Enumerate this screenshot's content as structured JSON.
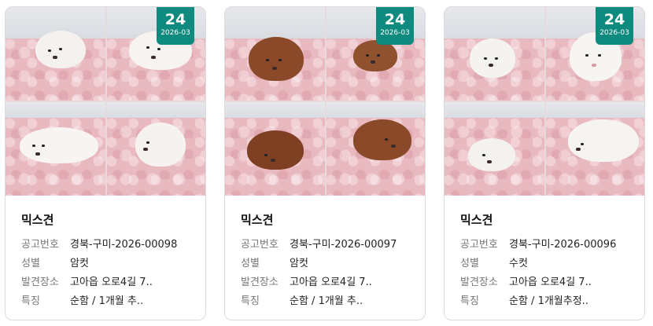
{
  "cards": [
    {
      "badge_day": "24",
      "badge_yearmonth": "2026-03",
      "breed": "믹스견",
      "labels": {
        "notice_no": "공고번호",
        "sex": "성별",
        "place": "발견장소",
        "feature": "특징"
      },
      "notice_no": "경북-구미-2026-00098",
      "sex": "암컷",
      "place": "고아읍 오로4길 7..",
      "feature": "순함 / 1개월 추..",
      "puppy_color": "#f4f1ee"
    },
    {
      "badge_day": "24",
      "badge_yearmonth": "2026-03",
      "breed": "믹스견",
      "labels": {
        "notice_no": "공고번호",
        "sex": "성별",
        "place": "발견장소",
        "feature": "특징"
      },
      "notice_no": "경북-구미-2026-00097",
      "sex": "암컷",
      "place": "고아읍 오로4길 7..",
      "feature": "순함 / 1개월 추..",
      "puppy_color": "#8a4a2a"
    },
    {
      "badge_day": "24",
      "badge_yearmonth": "2026-03",
      "breed": "믹스견",
      "labels": {
        "notice_no": "공고번호",
        "sex": "성별",
        "place": "발견장소",
        "feature": "특징"
      },
      "notice_no": "경북-구미-2026-00096",
      "sex": "수컷",
      "place": "고아읍 오로4길 7..",
      "feature": "순함 / 1개월추정..",
      "puppy_color": "#f5f3f0"
    }
  ],
  "colors": {
    "badge": "#0f8a7e",
    "blanket": "#e9b9c0"
  }
}
